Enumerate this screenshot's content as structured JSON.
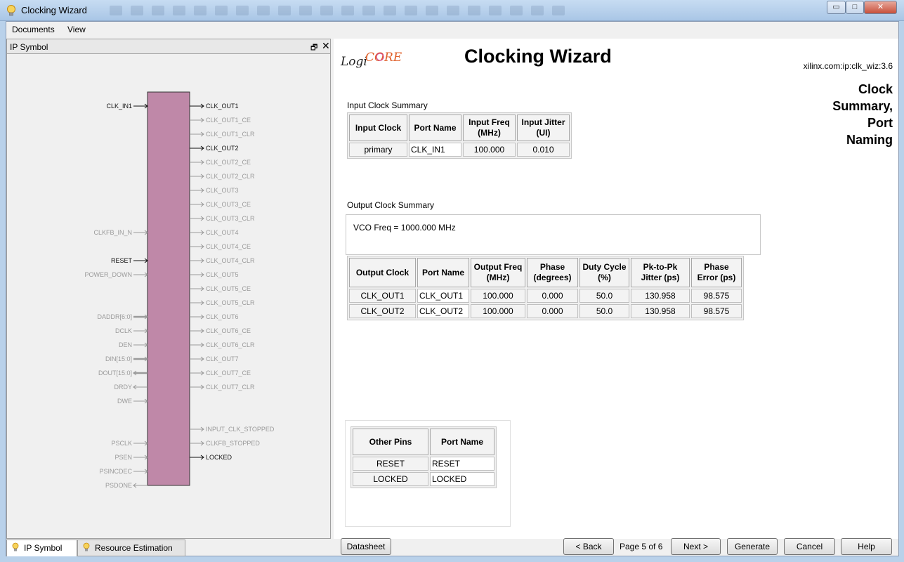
{
  "window": {
    "title": "Clocking Wizard",
    "minimize_glyph": "▭",
    "maximize_glyph": "□",
    "close_glyph": "✕"
  },
  "menu": {
    "documents": "Documents",
    "view": "View"
  },
  "left_pane": {
    "title": "IP Symbol",
    "restore_glyph": "🗗",
    "close_glyph": "✕",
    "block_color": "#bf88a8",
    "left_pins": [
      {
        "name": "CLK_IN1",
        "active": true,
        "dir": "in"
      },
      {
        "name": "CLKFB_IN_N",
        "active": false,
        "dir": "in"
      },
      {
        "name": "RESET",
        "active": true,
        "dir": "in"
      },
      {
        "name": "POWER_DOWN",
        "active": false,
        "dir": "in"
      },
      {
        "name": "DADDR[6:0]",
        "active": false,
        "dir": "in",
        "bus": true
      },
      {
        "name": "DCLK",
        "active": false,
        "dir": "in"
      },
      {
        "name": "DEN",
        "active": false,
        "dir": "in"
      },
      {
        "name": "DIN[15:0]",
        "active": false,
        "dir": "in",
        "bus": true
      },
      {
        "name": "DOUT[15:0]",
        "active": false,
        "dir": "out",
        "bus": true
      },
      {
        "name": "DRDY",
        "active": false,
        "dir": "out"
      },
      {
        "name": "DWE",
        "active": false,
        "dir": "in"
      },
      {
        "name": "PSCLK",
        "active": false,
        "dir": "in"
      },
      {
        "name": "PSEN",
        "active": false,
        "dir": "in"
      },
      {
        "name": "PSINCDEC",
        "active": false,
        "dir": "in"
      },
      {
        "name": "PSDONE",
        "active": false,
        "dir": "out"
      }
    ],
    "right_pins": [
      {
        "name": "CLK_OUT1",
        "active": true
      },
      {
        "name": "CLK_OUT1_CE",
        "active": false
      },
      {
        "name": "CLK_OUT1_CLR",
        "active": false
      },
      {
        "name": "CLK_OUT2",
        "active": true
      },
      {
        "name": "CLK_OUT2_CE",
        "active": false
      },
      {
        "name": "CLK_OUT2_CLR",
        "active": false
      },
      {
        "name": "CLK_OUT3",
        "active": false
      },
      {
        "name": "CLK_OUT3_CE",
        "active": false
      },
      {
        "name": "CLK_OUT3_CLR",
        "active": false
      },
      {
        "name": "CLK_OUT4",
        "active": false
      },
      {
        "name": "CLK_OUT4_CE",
        "active": false
      },
      {
        "name": "CLK_OUT4_CLR",
        "active": false
      },
      {
        "name": "CLK_OUT5",
        "active": false
      },
      {
        "name": "CLK_OUT5_CE",
        "active": false
      },
      {
        "name": "CLK_OUT5_CLR",
        "active": false
      },
      {
        "name": "CLK_OUT6",
        "active": false
      },
      {
        "name": "CLK_OUT6_CE",
        "active": false
      },
      {
        "name": "CLK_OUT6_CLR",
        "active": false
      },
      {
        "name": "CLK_OUT7",
        "active": false
      },
      {
        "name": "CLK_OUT7_CE",
        "active": false
      },
      {
        "name": "CLK_OUT7_CLR",
        "active": false
      },
      {
        "name": "INPUT_CLK_STOPPED",
        "active": false
      },
      {
        "name": "CLKFB_STOPPED",
        "active": false
      },
      {
        "name": "LOCKED",
        "active": true
      }
    ]
  },
  "tabs": {
    "ip_symbol": "IP Symbol",
    "resource_estimation": "Resource Estimation"
  },
  "header": {
    "logo_text_a": "Logi",
    "logo_text_b": "CORE",
    "title": "Clocking Wizard",
    "ip_id": "xilinx.com:ip:clk_wiz:3.6",
    "page_heading_lines": [
      "Clock",
      "Summary,",
      "Port",
      "Naming"
    ]
  },
  "input_summary": {
    "label": "Input Clock Summary",
    "headers": [
      "Input Clock",
      "Port Name",
      "Input Freq (MHz)",
      "Input Jitter (UI)"
    ],
    "rows": [
      {
        "clock": "primary",
        "port": "CLK_IN1",
        "freq": "100.000",
        "jitter": "0.010"
      }
    ]
  },
  "output_summary": {
    "label": "Output Clock Summary",
    "vco": "VCO Freq = 1000.000 MHz",
    "headers": [
      "Output Clock",
      "Port Name",
      "Output Freq (MHz)",
      "Phase (degrees)",
      "Duty Cycle (%)",
      "Pk-to-Pk Jitter (ps)",
      "Phase Error (ps)"
    ],
    "rows": [
      {
        "clock": "CLK_OUT1",
        "port": "CLK_OUT1",
        "freq": "100.000",
        "phase": "0.000",
        "duty": "50.0",
        "jitter": "130.958",
        "error": "98.575"
      },
      {
        "clock": "CLK_OUT2",
        "port": "CLK_OUT2",
        "freq": "100.000",
        "phase": "0.000",
        "duty": "50.0",
        "jitter": "130.958",
        "error": "98.575"
      }
    ]
  },
  "other_pins": {
    "headers": [
      "Other Pins",
      "Port Name"
    ],
    "rows": [
      {
        "pin": "RESET",
        "port": "RESET"
      },
      {
        "pin": "LOCKED",
        "port": "LOCKED"
      }
    ]
  },
  "footer": {
    "datasheet": "Datasheet",
    "back": "< Back",
    "page": "Page 5 of 6",
    "next": "Next >",
    "generate": "Generate",
    "cancel": "Cancel",
    "help": "Help"
  }
}
